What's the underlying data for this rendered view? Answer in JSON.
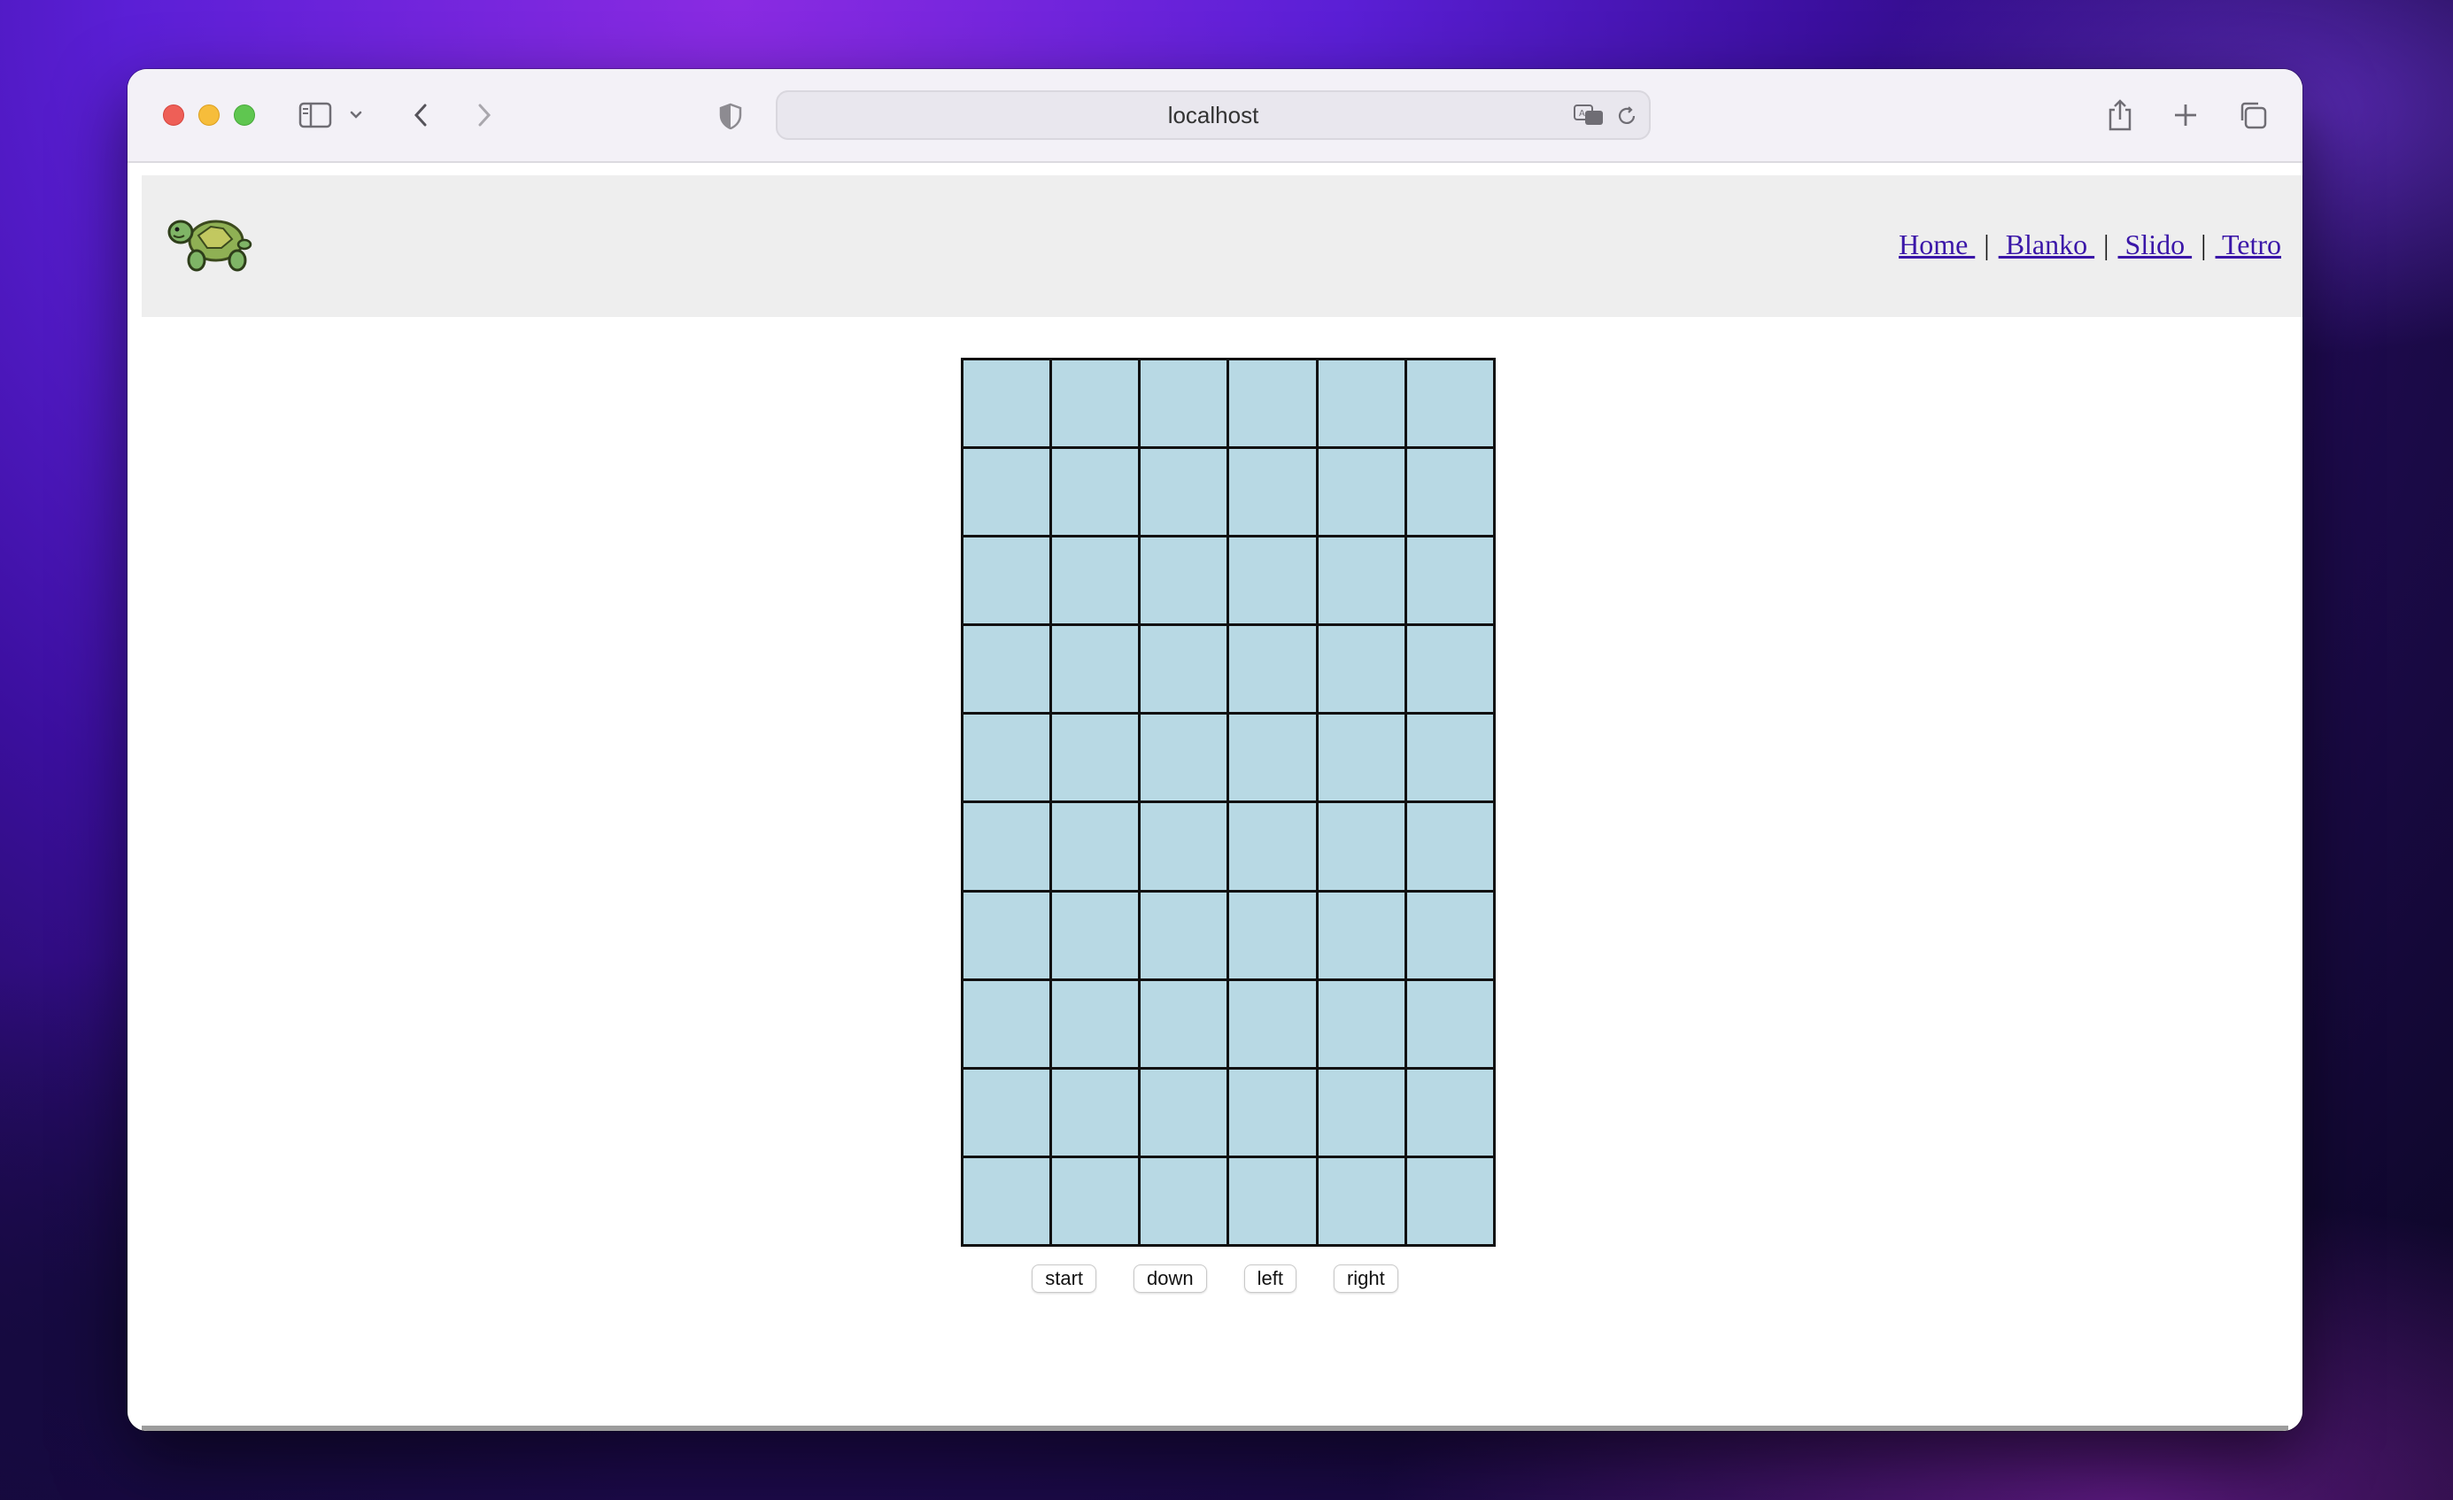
{
  "browser": {
    "url": "localhost"
  },
  "site": {
    "nav": [
      {
        "label": "Home "
      },
      {
        "label": " Blanko "
      },
      {
        "label": " Slido "
      },
      {
        "label": " Tetro"
      }
    ],
    "separator": "|"
  },
  "board": {
    "columns": 6,
    "rows": 10,
    "cell_color": "#b8d9e4",
    "border_color": "#111111"
  },
  "controls": {
    "start": "start",
    "down": "down",
    "left": "left",
    "right": "right"
  },
  "icons": {
    "logo": "turtle-logo-icon"
  }
}
